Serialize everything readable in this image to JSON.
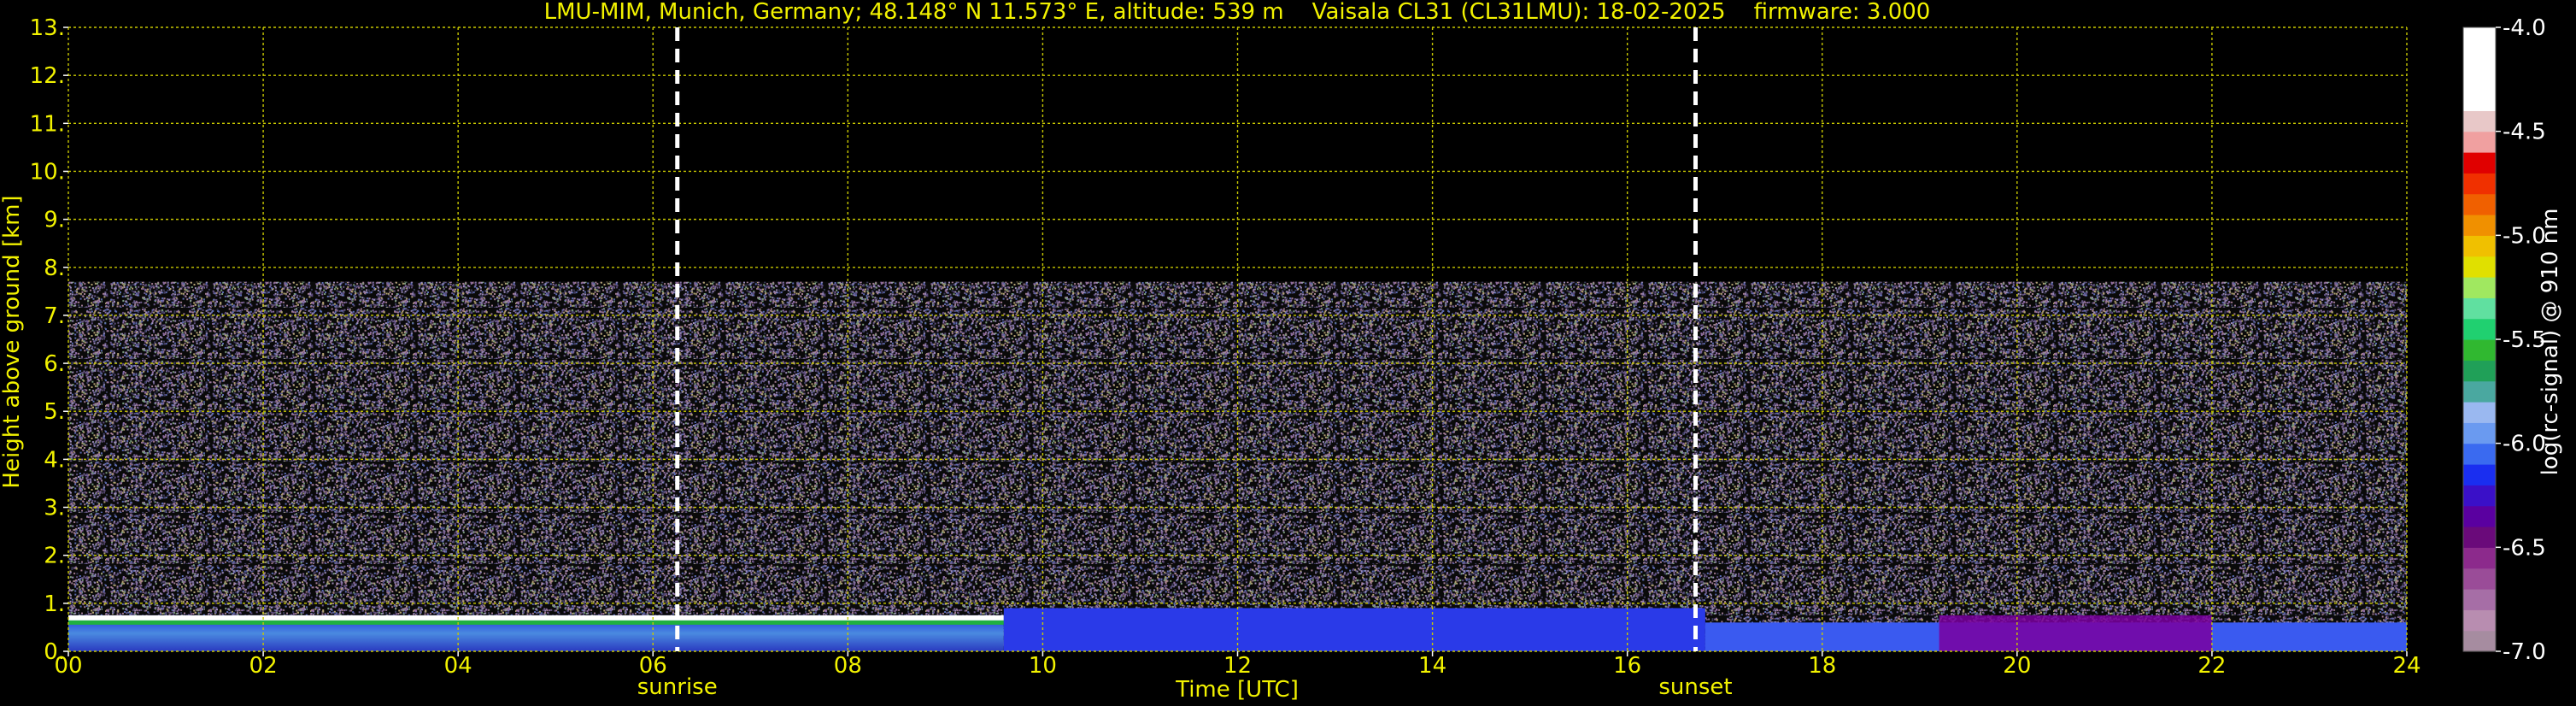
{
  "chart_data": {
    "type": "heatmap",
    "title": "LMU-MIM, Munich, Germany; 48.148° N 11.573° E, altitude: 539 m    Vaisala CL31 (CL31LMU): 18-02-2025    firmware: 3.000",
    "xlabel": "Time [UTC]",
    "ylabel": "Height above ground [km]",
    "colorbar_label": "log(rc-signal) @ 910 nm",
    "xlim": [
      0,
      24
    ],
    "ylim": [
      0,
      13
    ],
    "x_ticks": [
      "00",
      "02",
      "04",
      "06",
      "08",
      "10",
      "12",
      "14",
      "16",
      "18",
      "20",
      "22",
      "24"
    ],
    "y_ticks": [
      "0.",
      "1.",
      "2.",
      "3.",
      "4.",
      "5.",
      "6.",
      "7.",
      "8.",
      "9.",
      "10.",
      "11.",
      "12.",
      "13."
    ],
    "colorbar_range": [
      -7.0,
      -4.0
    ],
    "colorbar_ticks": [
      "-7.0",
      "-6.5",
      "-6.0",
      "-5.5",
      "-5.0",
      "-4.5",
      "-4.0"
    ],
    "colorbar_colors": [
      "#a68ca0",
      "#b88db0",
      "#a66ea6",
      "#9a4c98",
      "#8c2a8c",
      "#6a0a7a",
      "#5a00a0",
      "#3a10c8",
      "#1a2ef0",
      "#3a6af0",
      "#6a9af0",
      "#9ab8f0",
      "#4aa8a0",
      "#20a058",
      "#30b830",
      "#20d070",
      "#60e0a0",
      "#a0e860",
      "#e0e000",
      "#f0c000",
      "#f09000",
      "#f06000",
      "#f03000",
      "#e00000",
      "#f0a0a0",
      "#e8c8c8",
      "#ffffff",
      "#ffffff",
      "#ffffff",
      "#ffffff"
    ],
    "vertical_markers": [
      {
        "label": "sunrise",
        "x": 6.25
      },
      {
        "label": "sunset",
        "x": 16.7
      }
    ],
    "signal_top_km": 7.7,
    "layers": [
      {
        "x": [
          0,
          9.6
        ],
        "top_km": 0.75,
        "color": "#ffffff"
      },
      {
        "x": [
          9.6,
          16.8
        ],
        "top_km": 0.9,
        "color": "#2a3ae8"
      },
      {
        "x": [
          16.8,
          24
        ],
        "top_km": 0.6,
        "color": "#3a5af0"
      },
      {
        "x": [
          19.2,
          22
        ],
        "top_km": 0.75,
        "color": "#7a00a0"
      }
    ],
    "grid": true,
    "grid_color": "#c8c800"
  }
}
